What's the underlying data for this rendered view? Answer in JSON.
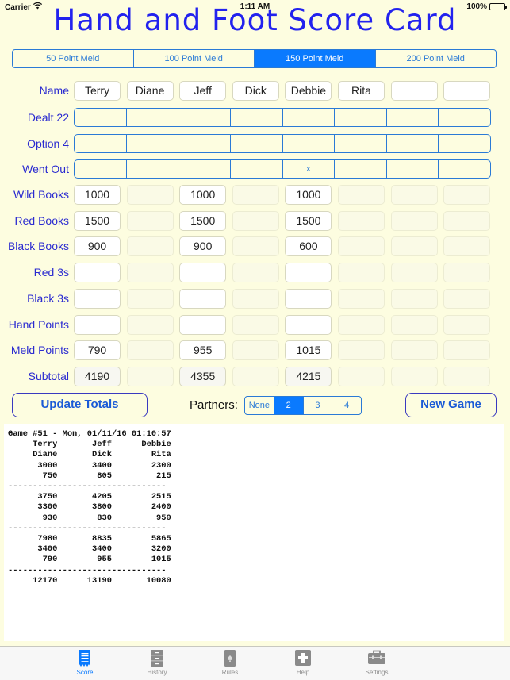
{
  "status_bar": {
    "carrier": "Carrier",
    "time": "1:11 AM",
    "battery": "100%"
  },
  "title": "Hand and Foot Score Card",
  "meld_options": [
    {
      "label": "50 Point Meld",
      "selected": false
    },
    {
      "label": "100 Point Meld",
      "selected": false
    },
    {
      "label": "150 Point Meld",
      "selected": true
    },
    {
      "label": "200 Point Meld",
      "selected": false
    }
  ],
  "name_row": {
    "label": "Name",
    "players": [
      "Terry",
      "Diane",
      "Jeff",
      "Dick",
      "Debbie",
      "Rita",
      "",
      ""
    ]
  },
  "toggle_rows": [
    {
      "label": "Dealt 22",
      "marks": [
        "",
        "",
        "",
        "",
        "",
        "",
        "",
        ""
      ]
    },
    {
      "label": "Option 4",
      "marks": [
        "",
        "",
        "",
        "",
        "",
        "",
        "",
        ""
      ]
    },
    {
      "label": "Went Out",
      "marks": [
        "",
        "",
        "",
        "",
        "x",
        "",
        "",
        ""
      ]
    }
  ],
  "score_rows": [
    {
      "label": "Wild Books",
      "values": [
        "1000",
        "",
        "1000",
        "",
        "1000",
        "",
        "",
        ""
      ]
    },
    {
      "label": "Red Books",
      "values": [
        "1500",
        "",
        "1500",
        "",
        "1500",
        "",
        "",
        ""
      ]
    },
    {
      "label": "Black Books",
      "values": [
        "900",
        "",
        "900",
        "",
        "600",
        "",
        "",
        ""
      ]
    },
    {
      "label": "Red 3s",
      "values": [
        "",
        "",
        "",
        "",
        "",
        "",
        "",
        ""
      ]
    },
    {
      "label": "Black 3s",
      "values": [
        "",
        "",
        "",
        "",
        "",
        "",
        "",
        ""
      ]
    },
    {
      "label": "Hand Points",
      "values": [
        "",
        "",
        "",
        "",
        "",
        "",
        "",
        ""
      ]
    },
    {
      "label": "Meld Points",
      "values": [
        "790",
        "",
        "955",
        "",
        "1015",
        "",
        "",
        ""
      ]
    },
    {
      "label": "Subtotal",
      "values": [
        "4190",
        "",
        "4355",
        "",
        "4215",
        "",
        "",
        ""
      ]
    }
  ],
  "active_columns": [
    true,
    false,
    true,
    false,
    true,
    false,
    false,
    false
  ],
  "buttons": {
    "update_totals": "Update Totals",
    "new_game": "New Game"
  },
  "partners": {
    "label": "Partners:",
    "options": [
      {
        "label": "None",
        "selected": false
      },
      {
        "label": "2",
        "selected": true
      },
      {
        "label": "3",
        "selected": false
      },
      {
        "label": "4",
        "selected": false
      }
    ]
  },
  "history_log": "Game #51 - Mon, 01/11/16 01:10:57\n     Terry       Jeff      Debbie\n     Diane       Dick        Rita\n      3000       3400        2300\n       750        805         215\n--------------------------------\n      3750       4205        2515\n      3300       3800        2400\n       930        830         950\n--------------------------------\n      7980       8835        5865\n      3400       3400        3200\n       790        955        1015\n--------------------------------\n     12170      13190       10080",
  "tabs": [
    {
      "label": "Score",
      "icon": "score-sheet-icon",
      "active": true
    },
    {
      "label": "History",
      "icon": "file-cabinet-icon",
      "active": false
    },
    {
      "label": "Rules",
      "icon": "spade-card-icon",
      "active": false
    },
    {
      "label": "Help",
      "icon": "plus-box-icon",
      "active": false
    },
    {
      "label": "Settings",
      "icon": "toolbox-icon",
      "active": false
    }
  ]
}
